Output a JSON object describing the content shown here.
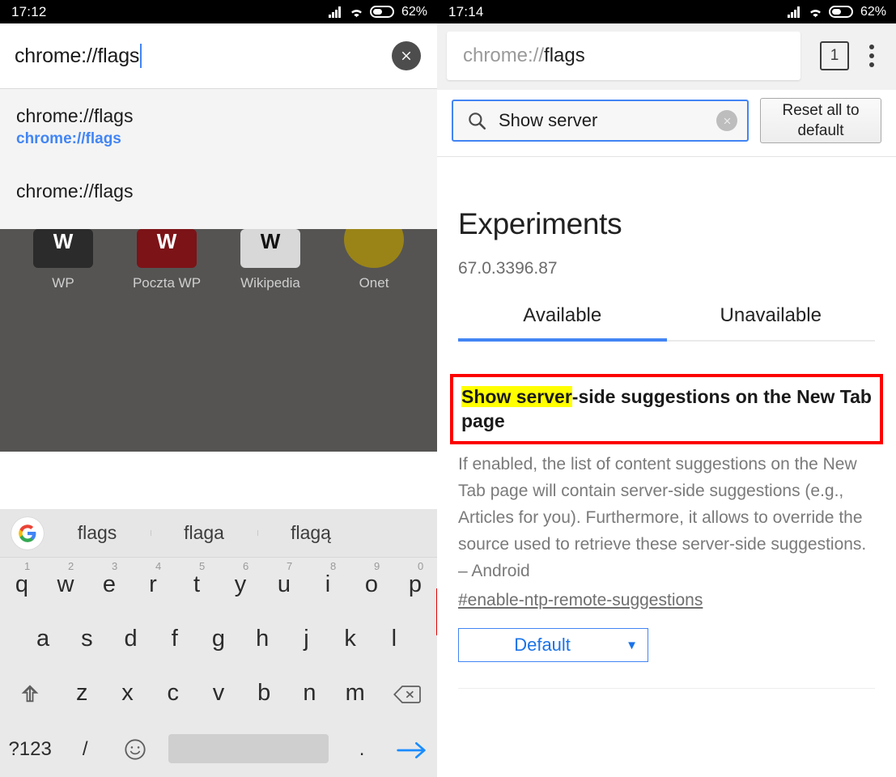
{
  "left": {
    "status": {
      "clock": "17:12",
      "battery_pct": "62%",
      "icons": [
        "signal-icon",
        "wifi-icon",
        "battery-icon"
      ]
    },
    "omnibox": {
      "value": "chrome://flags",
      "clear_icon": "clear-circle-icon"
    },
    "suggestions": [
      {
        "line1": "chrome://flags",
        "line2": "chrome://flags"
      },
      {
        "line1": "chrome://flags",
        "line2": ""
      }
    ],
    "ntp_tiles": [
      {
        "label": "WP",
        "glyph": "W",
        "color": "#2b2b2b",
        "shape": "rect"
      },
      {
        "label": "Poczta WP",
        "glyph": "W",
        "color": "#7c1317",
        "shape": "rect"
      },
      {
        "label": "Wikipedia",
        "glyph": "W",
        "color": "#d8d8d8",
        "shape": "rect"
      },
      {
        "label": "Onet",
        "glyph": "",
        "color": "#9a8418",
        "shape": "circle"
      }
    ],
    "keyboard": {
      "google_icon": "google-g-icon",
      "suggestions": [
        "flags",
        "flaga",
        "flagą"
      ],
      "row1": [
        {
          "k": "q",
          "n": "1"
        },
        {
          "k": "w",
          "n": "2"
        },
        {
          "k": "e",
          "n": "3"
        },
        {
          "k": "r",
          "n": "4"
        },
        {
          "k": "t",
          "n": "5"
        },
        {
          "k": "y",
          "n": "6"
        },
        {
          "k": "u",
          "n": "7"
        },
        {
          "k": "i",
          "n": "8"
        },
        {
          "k": "o",
          "n": "9"
        },
        {
          "k": "p",
          "n": "0"
        }
      ],
      "row2": [
        "a",
        "s",
        "d",
        "f",
        "g",
        "h",
        "j",
        "k",
        "l"
      ],
      "row3": [
        "z",
        "x",
        "c",
        "v",
        "b",
        "n",
        "m"
      ],
      "shift_icon": "shift-arrow-icon",
      "backspace_icon": "backspace-icon",
      "sym_key": "?123",
      "slash_key": "/",
      "emoji_icon": "emoji-smiley-icon",
      "period_key": ".",
      "enter_icon": "enter-arrow-icon"
    }
  },
  "right": {
    "status": {
      "clock": "17:14",
      "battery_pct": "62%"
    },
    "urlbar": {
      "scheme": "chrome://",
      "host": "flags",
      "tab_count": "1",
      "menu_icon": "three-dot-menu-icon"
    },
    "flags_search": {
      "value": "Show server",
      "search_icon": "search-magnifier-icon",
      "clear_icon": "clear-x-icon",
      "reset_label": "Reset all to default"
    },
    "page": {
      "title": "Experiments",
      "version": "67.0.3396.87",
      "tabs": [
        {
          "label": "Available",
          "active": true
        },
        {
          "label": "Unavailable",
          "active": false
        }
      ],
      "flag": {
        "title_highlight": "Show server",
        "title_rest": "-side suggestions on the New Tab page",
        "description": "If enabled, the list of content suggestions on the New Tab page will contain server-side suggestions (e.g., Articles for you). Furthermore, it allows to override the source used to retrieve these server-side suggestions. – Android",
        "permalink": "#enable-ntp-remote-suggestions",
        "select_value": "Default",
        "select_arrow": "▼"
      }
    }
  },
  "colors": {
    "accent_blue": "#4285f4",
    "link_blue": "#1a73e8",
    "highlight_yellow": "#ffff00",
    "annotation_red": "#fc0000",
    "status_black": "#000000"
  }
}
